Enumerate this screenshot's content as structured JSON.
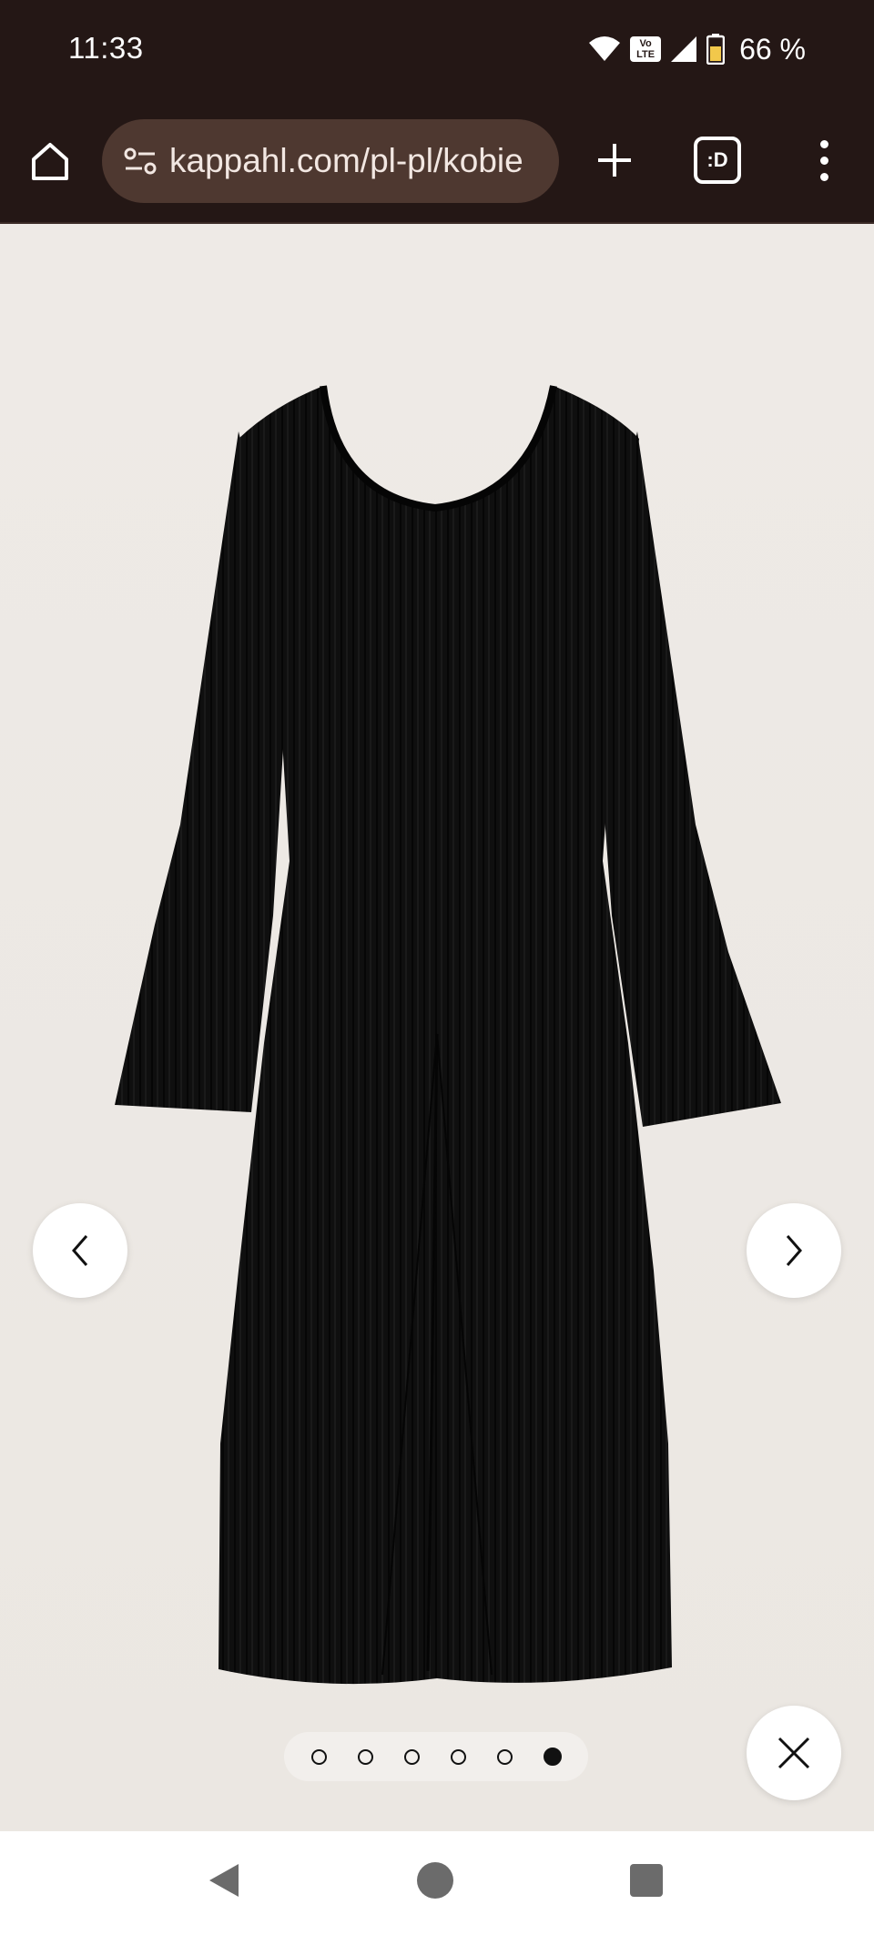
{
  "status_bar": {
    "time": "11:33",
    "volte_top": "Vo",
    "volte_bottom": "LTE",
    "battery": "66 %"
  },
  "browser": {
    "url": "kappahl.com/pl-pl/kobie",
    "tabs_label": ":D"
  },
  "gallery": {
    "total_images": 6,
    "active_index": 5
  },
  "colors": {
    "toolbar_bg": "#241715",
    "url_bar_bg": "#4e3830",
    "gallery_bg": "#ede9e4",
    "product_color": "#0e0e0e"
  }
}
